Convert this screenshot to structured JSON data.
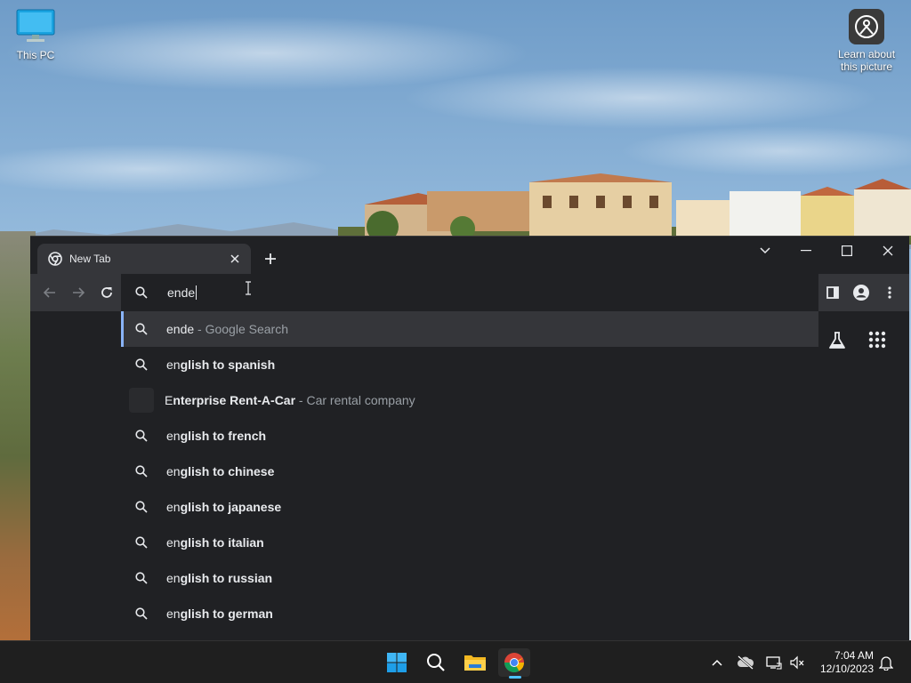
{
  "desktop": {
    "icons": [
      {
        "label": "This PC"
      },
      {
        "label": "Learn about this picture"
      }
    ]
  },
  "browser": {
    "tab": {
      "title": "New Tab"
    },
    "omnibox": {
      "value": "ende"
    },
    "suggestions": [
      {
        "typed": "ende",
        "completion": "",
        "description": " - Google Search",
        "icon": "search-icon"
      },
      {
        "typed": "en",
        "completion": "glish to spanish",
        "description": "",
        "icon": "search-icon"
      },
      {
        "typed": "E",
        "completion": "nterprise Rent-A-Car",
        "description": " - Car rental company",
        "icon": "entity-icon"
      },
      {
        "typed": "en",
        "completion": "glish to french",
        "description": "",
        "icon": "search-icon"
      },
      {
        "typed": "en",
        "completion": "glish to chinese",
        "description": "",
        "icon": "search-icon"
      },
      {
        "typed": "en",
        "completion": "glish to japanese",
        "description": "",
        "icon": "search-icon"
      },
      {
        "typed": "en",
        "completion": "glish to italian",
        "description": "",
        "icon": "search-icon"
      },
      {
        "typed": "en",
        "completion": "glish to russian",
        "description": "",
        "icon": "search-icon"
      },
      {
        "typed": "en",
        "completion": "glish to german",
        "description": "",
        "icon": "search-icon"
      }
    ]
  },
  "taskbar": {
    "clock": {
      "time": "7:04 AM",
      "date": "12/10/2023"
    }
  },
  "colors": {
    "accent": "#8ab4f8",
    "chrome_bg": "#202124",
    "toolbar_bg": "#35363a",
    "taskbar_bg": "#1f1f1f"
  }
}
